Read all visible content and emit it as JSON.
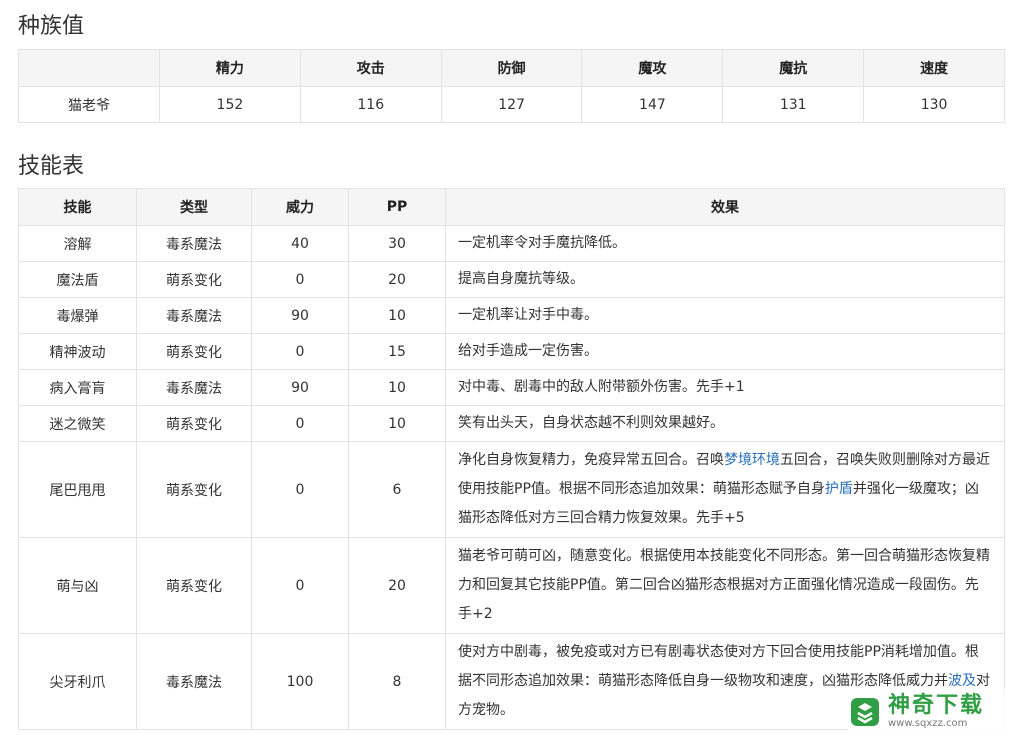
{
  "sections": {
    "stats_title": "种族值",
    "skills_title": "技能表"
  },
  "stats": {
    "headers": [
      "",
      "精力",
      "攻击",
      "防御",
      "魔攻",
      "魔抗",
      "速度"
    ],
    "row": [
      "猫老爷",
      "152",
      "116",
      "127",
      "147",
      "131",
      "130"
    ]
  },
  "skills": {
    "headers": [
      "技能",
      "类型",
      "威力",
      "PP",
      "效果"
    ],
    "rows": [
      {
        "name": "溶解",
        "type": "毒系魔法",
        "power": "40",
        "pp": "30",
        "effect": "一定机率令对手魔抗降低。"
      },
      {
        "name": "魔法盾",
        "type": "萌系变化",
        "power": "0",
        "pp": "20",
        "effect": "提高自身魔抗等级。"
      },
      {
        "name": "毒爆弹",
        "type": "毒系魔法",
        "power": "90",
        "pp": "10",
        "effect": "一定机率让对手中毒。"
      },
      {
        "name": "精神波动",
        "type": "萌系变化",
        "power": "0",
        "pp": "15",
        "effect": "给对手造成一定伤害。"
      },
      {
        "name": "病入膏肓",
        "type": "毒系魔法",
        "power": "90",
        "pp": "10",
        "effect": "对中毒、剧毒中的敌人附带额外伤害。先手+1"
      },
      {
        "name": "迷之微笑",
        "type": "萌系变化",
        "power": "0",
        "pp": "10",
        "effect": "笑有出头天，自身状态越不利则效果越好。"
      },
      {
        "name": "尾巴甩甩",
        "type": "萌系变化",
        "power": "0",
        "pp": "6",
        "effect_parts": [
          "净化自身恢复精力，免疫异常五回合。召唤",
          "梦境环境",
          "五回合，召唤失败则删除对方最近使用技能PP值。根据不同形态追加效果：萌猫形态赋予自身",
          "护盾",
          "并强化一级魔攻；凶猫形态降低对方三回合精力恢复效果。先手+5"
        ]
      },
      {
        "name": "萌与凶",
        "type": "萌系变化",
        "power": "0",
        "pp": "20",
        "effect": "猫老爷可萌可凶，随意变化。根据使用本技能变化不同形态。第一回合萌猫形态恢复精力和回复其它技能PP值。第二回合凶猫形态根据对方正面强化情况造成一段固伤。先手+2"
      },
      {
        "name": "尖牙利爪",
        "type": "毒系魔法",
        "power": "100",
        "pp": "8",
        "effect_parts": [
          "使对方中剧毒，被免疫或对方已有剧毒状态使对方下回合使用技能PP消耗增加值。根据不同形态追加效果：萌猫形态降低自身一级物攻和速度，凶猫形态降低威力并",
          "波及",
          "对方宠物。"
        ]
      }
    ]
  },
  "watermark": {
    "main": "神奇下载",
    "sub": "www.sqxzz.com"
  }
}
